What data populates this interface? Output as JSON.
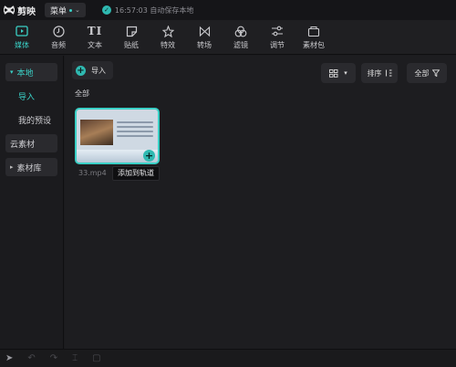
{
  "app": {
    "name": "剪映",
    "menu_label": "菜单",
    "save_status": "16:57:03 自动保存本地"
  },
  "tools": [
    {
      "label": "媒体",
      "icon": "media-icon",
      "active": true
    },
    {
      "label": "音频",
      "icon": "audio-icon"
    },
    {
      "label": "文本",
      "icon": "text-icon",
      "glyph": "TI"
    },
    {
      "label": "贴纸",
      "icon": "sticker-icon"
    },
    {
      "label": "特效",
      "icon": "effects-icon"
    },
    {
      "label": "转场",
      "icon": "transition-icon"
    },
    {
      "label": "滤镜",
      "icon": "filter-icon"
    },
    {
      "label": "调节",
      "icon": "adjust-icon"
    },
    {
      "label": "素材包",
      "icon": "package-icon"
    }
  ],
  "sidebar": {
    "local": "本地",
    "import": "导入",
    "my_presets": "我的预设",
    "cloud": "云素材",
    "library": "素材库"
  },
  "main": {
    "import_button": "导入",
    "sort_label": "排序",
    "filter_label": "全部",
    "section_label": "全部",
    "media": {
      "filename": "33.mp4",
      "tooltip": "添加到轨道"
    }
  },
  "colors": {
    "accent": "#3ad0c6",
    "background": "#1b1b1e",
    "panel": "#2a2a2e"
  }
}
